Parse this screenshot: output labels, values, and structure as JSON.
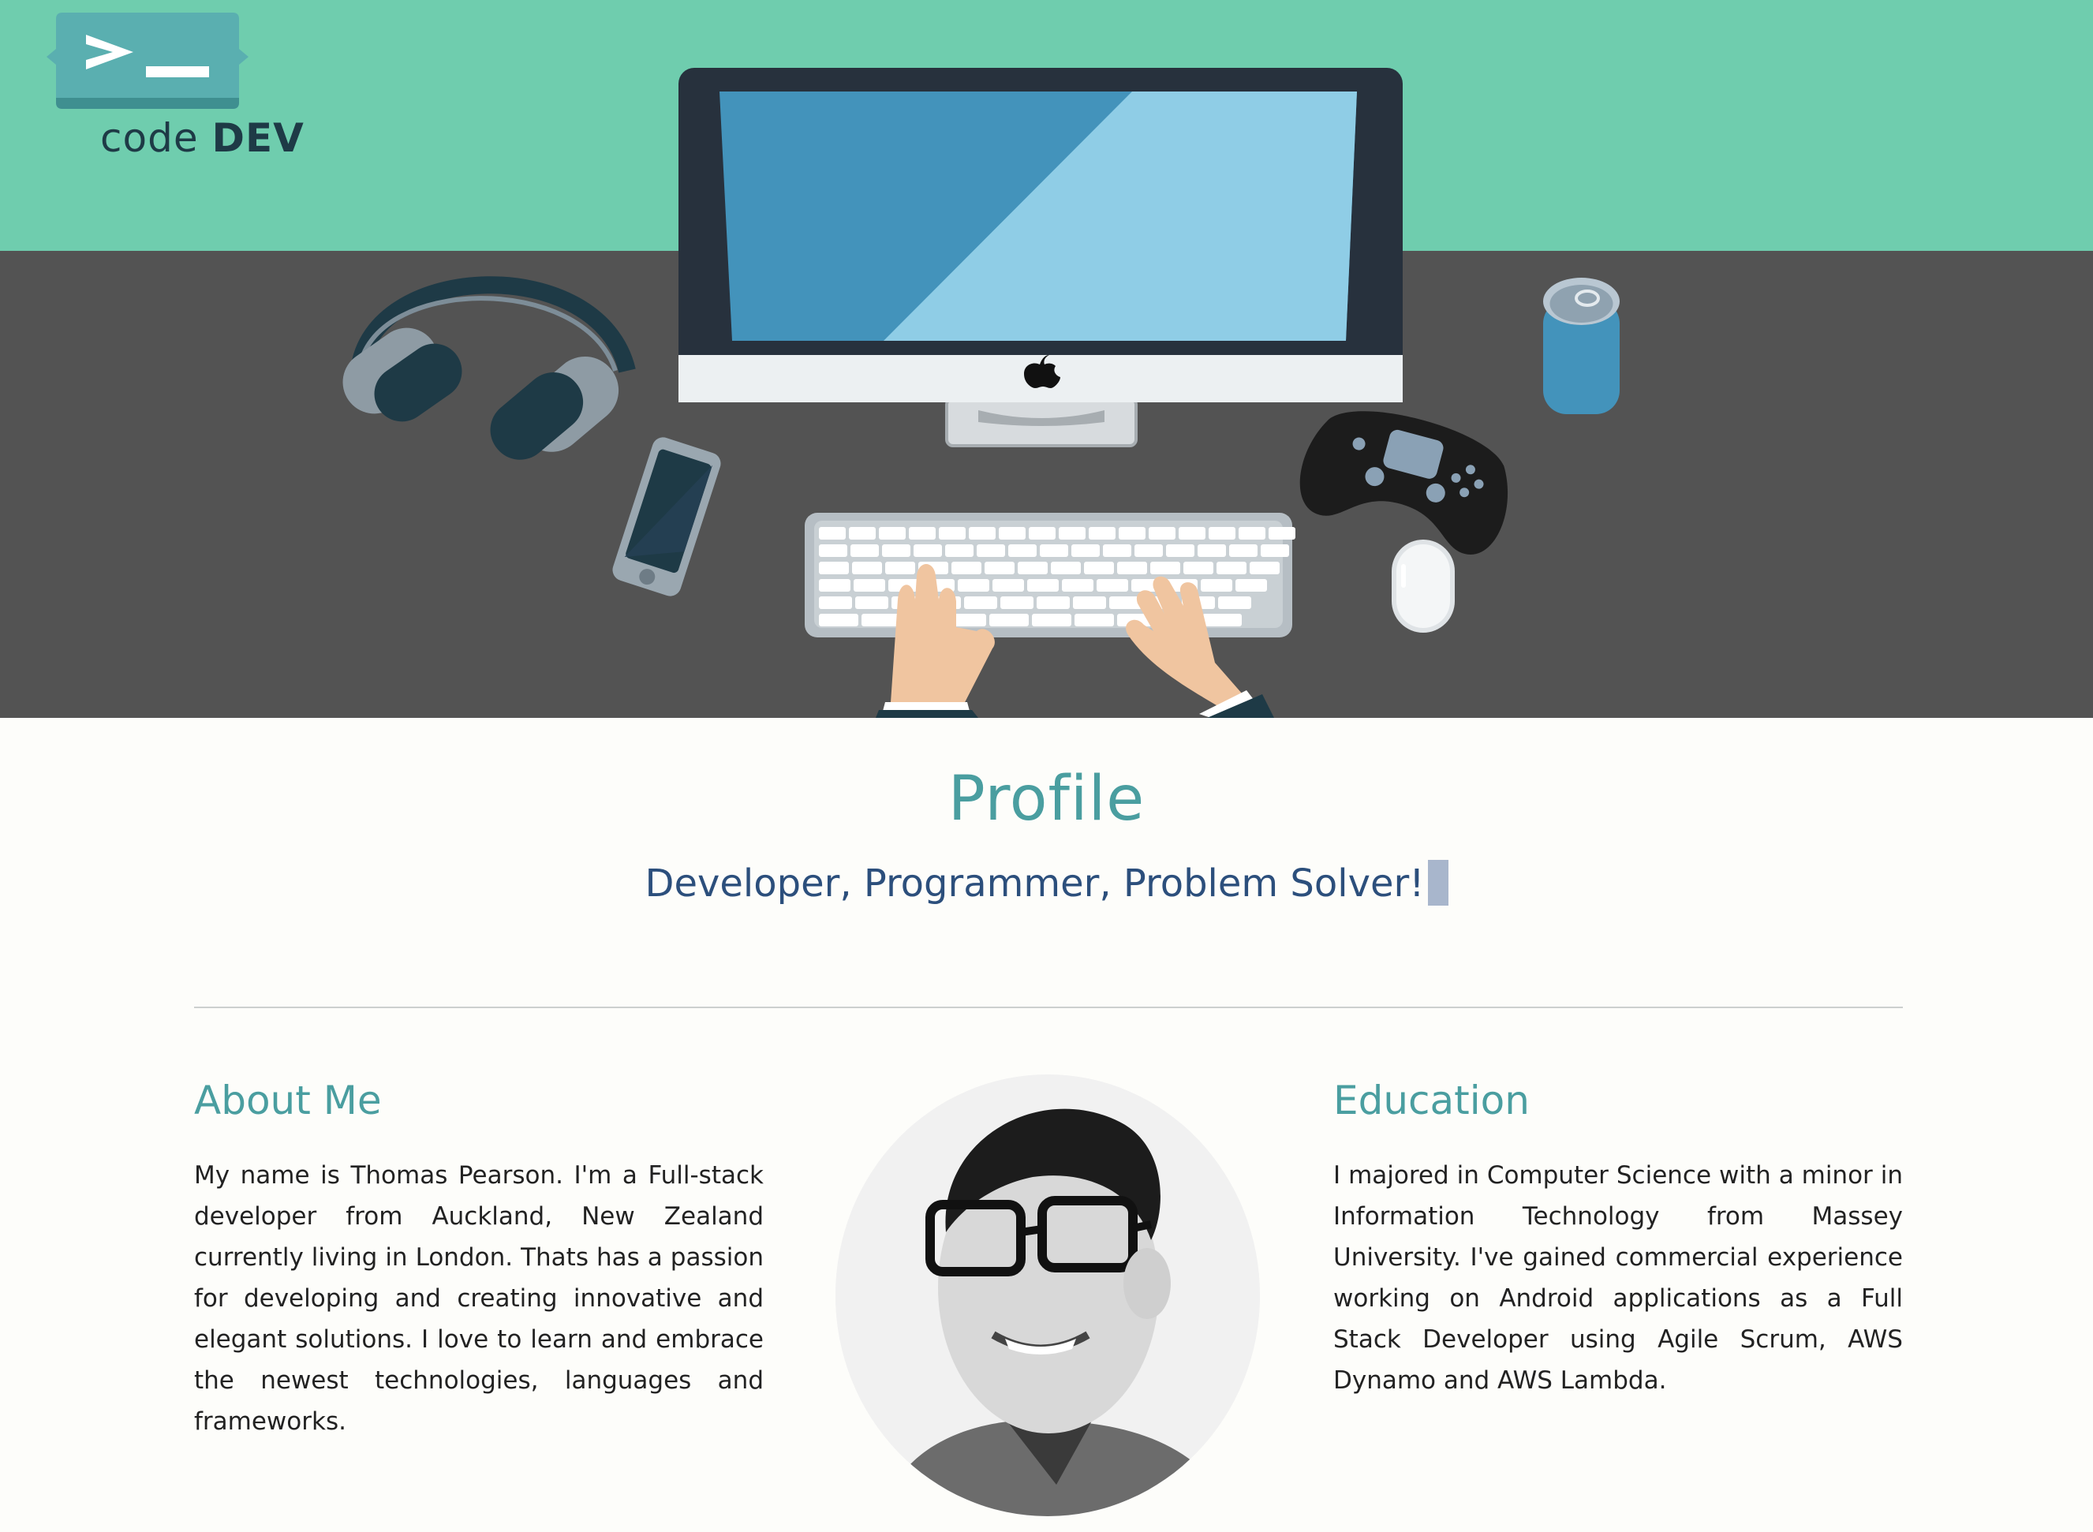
{
  "logo": {
    "prompt_symbol": ">_",
    "text_prefix": "code",
    "text_suffix": "DEV",
    "icon": "terminal-prompt-icon"
  },
  "hero": {
    "illustration": "developer-desk-illustration",
    "colors": {
      "wall": "#6fcdae",
      "desk": "#535353",
      "screen_dark": "#4393bb",
      "screen_light": "#8fcde6"
    }
  },
  "profile": {
    "title": "Profile",
    "subtitle": "Developer, Programmer, Problem Solver!"
  },
  "about": {
    "title": "About Me",
    "text": "My name is Thomas Pearson. I'm a Full-stack developer from Auckland, New Zealand currently living in London. Thats has a passion for developing and creating innovative and elegant solutions. I love to learn and embrace the newest technologies, languages and frameworks."
  },
  "education": {
    "title": "Education",
    "text": "I majored in Computer Science with a minor in Information Technology from Massey University. I've gained commercial experience working on Android applications as a Full Stack Developer using Agile Scrum, AWS Dynamo and AWS Lambda."
  },
  "avatar": {
    "icon": "profile-photo"
  },
  "colors": {
    "accent": "#4a9ea0",
    "subtitle": "#2c4f7c",
    "background": "#fdfdfa"
  }
}
